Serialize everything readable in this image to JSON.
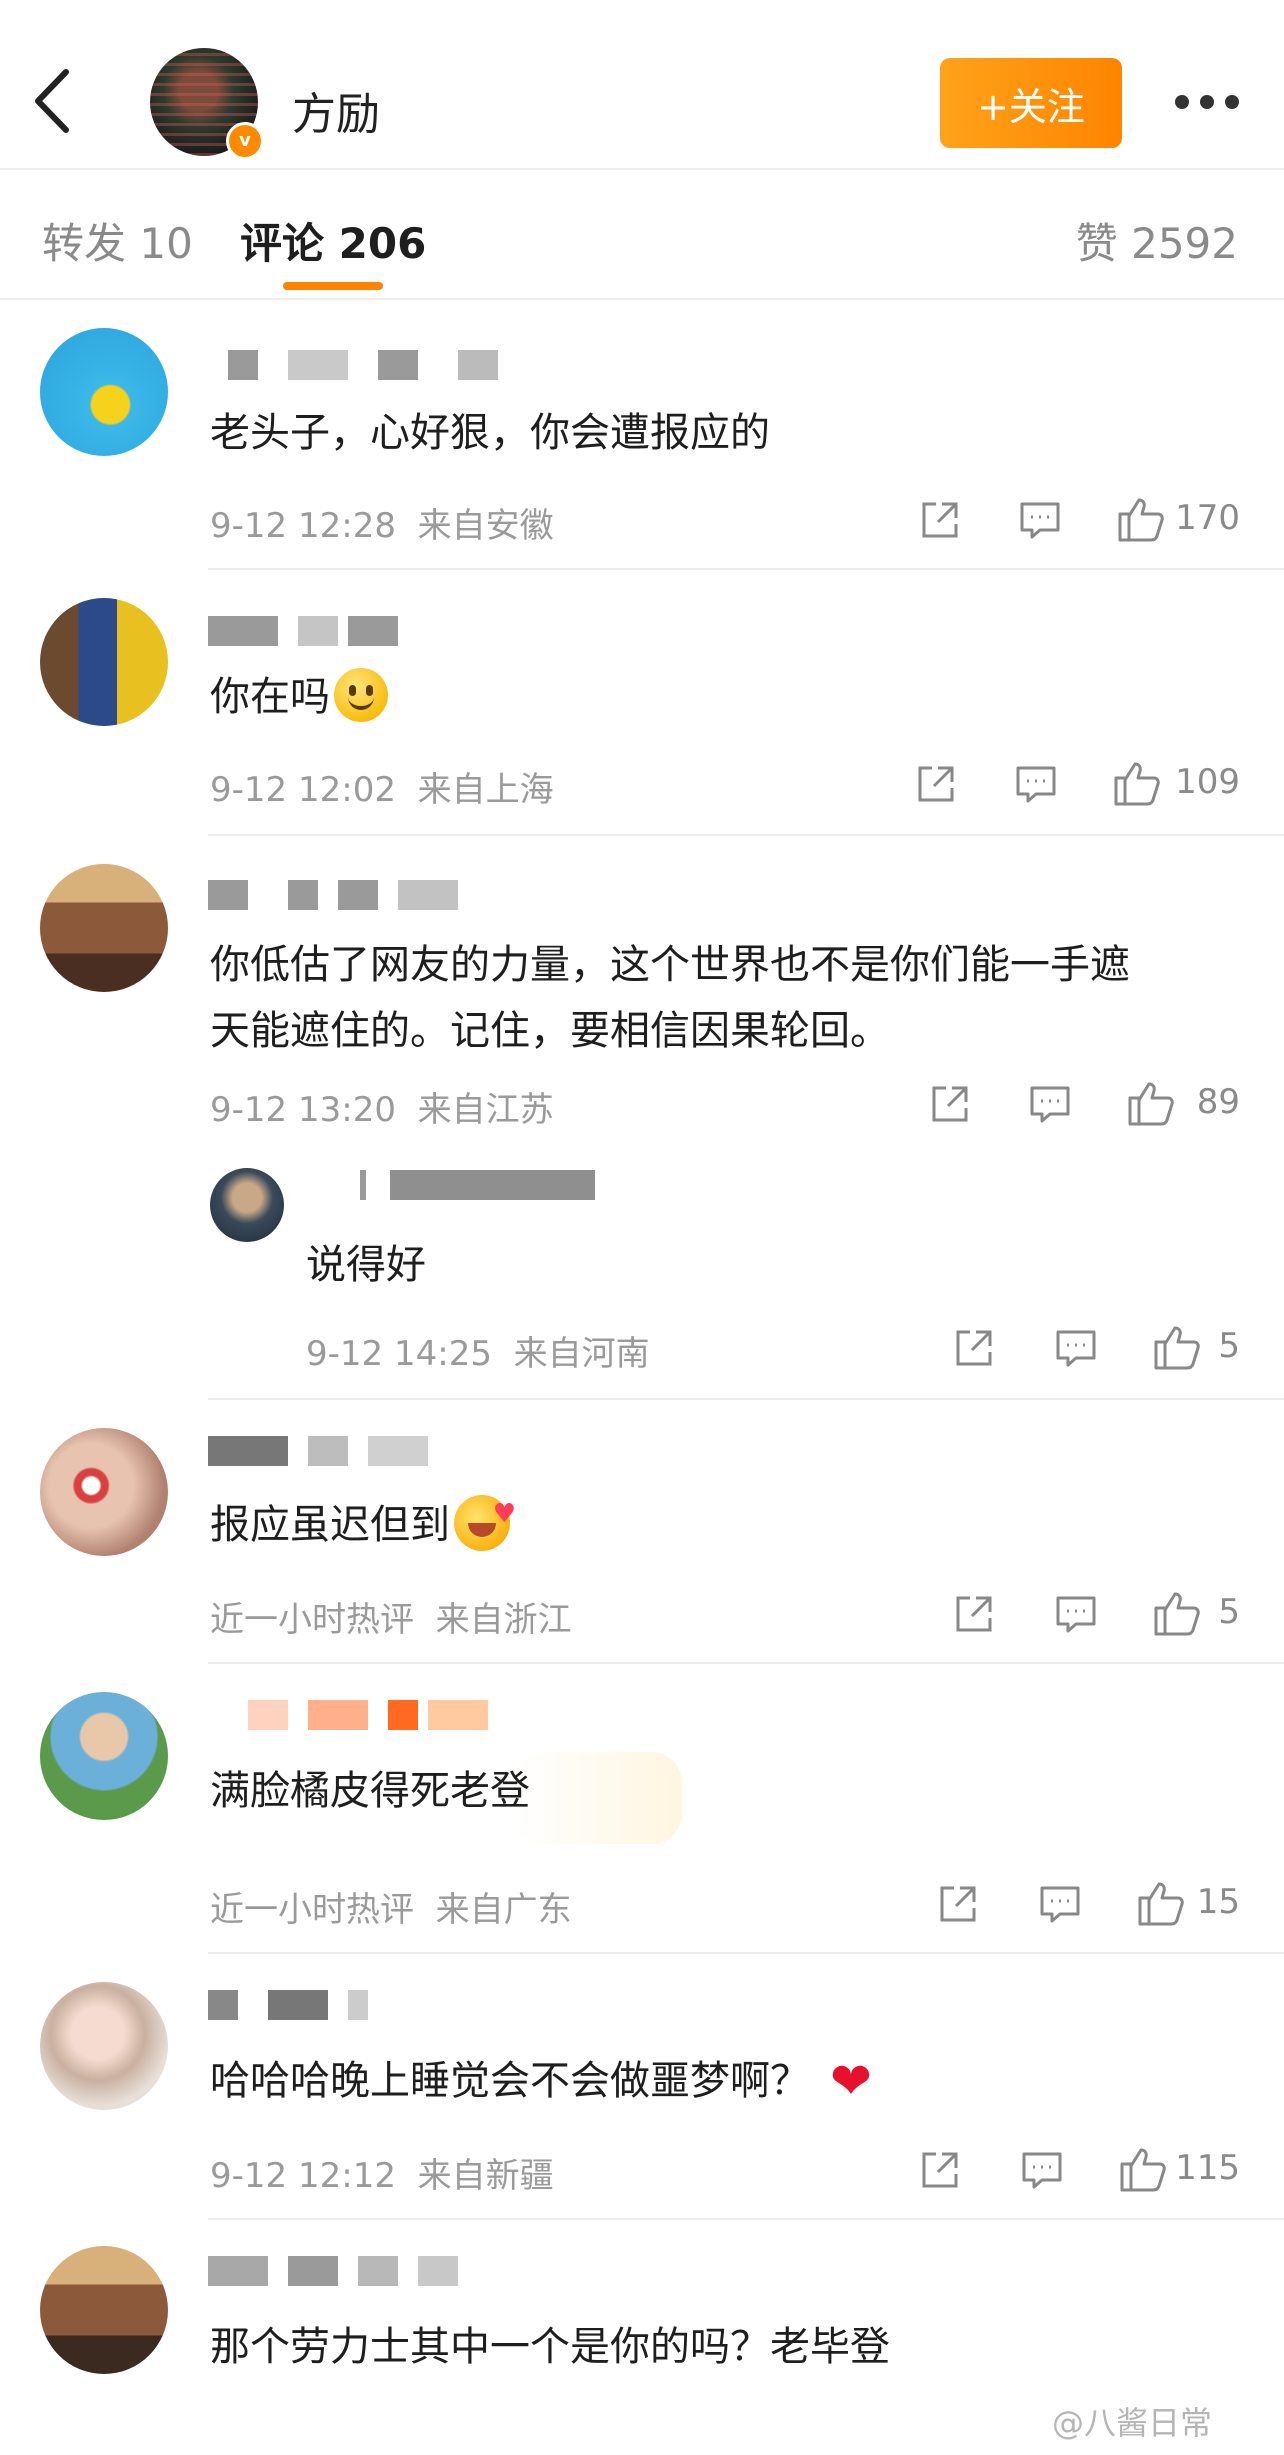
{
  "header": {
    "author_name": "方励",
    "follow_label": "+关注",
    "verified_badge": "v"
  },
  "tabs": {
    "repost_label": "转发 10",
    "comment_label": "评论 206",
    "like_label": "赞 2592"
  },
  "comments": [
    {
      "text": "老头子，心好狠，你会遭报应的",
      "time": "9-12 12:28",
      "location": "来自安徽",
      "likes": "170"
    },
    {
      "text": "你在吗",
      "time": "9-12 12:02",
      "location": "来自上海",
      "likes": "109"
    },
    {
      "text_line1": "你低估了网友的力量，这个世界也不是你们能一手遮",
      "text_line2": "天能遮住的。记住，要相信因果轮回。",
      "time": "9-12 13:20",
      "location": "来自江苏",
      "likes": "89",
      "reply": {
        "text": "说得好",
        "time": "9-12 14:25",
        "location": "来自河南",
        "likes": "5"
      }
    },
    {
      "text": "报应虽迟但到",
      "time": "近一小时热评",
      "location": "来自浙江",
      "likes": "5"
    },
    {
      "text": "满脸橘皮得死老登",
      "time": "近一小时热评",
      "location": "来自广东",
      "likes": "15"
    },
    {
      "text": "哈哈哈晚上睡觉会不会做噩梦啊？",
      "time": "9-12 12:12",
      "location": "来自新疆",
      "likes": "115"
    },
    {
      "text": "那个劳力士其中一个是你的吗？老毕登"
    }
  ],
  "watermark": "@八酱日常",
  "colors": {
    "accent": "#ff8200",
    "text": "#1e1e1e",
    "meta": "#9a9a9a"
  }
}
